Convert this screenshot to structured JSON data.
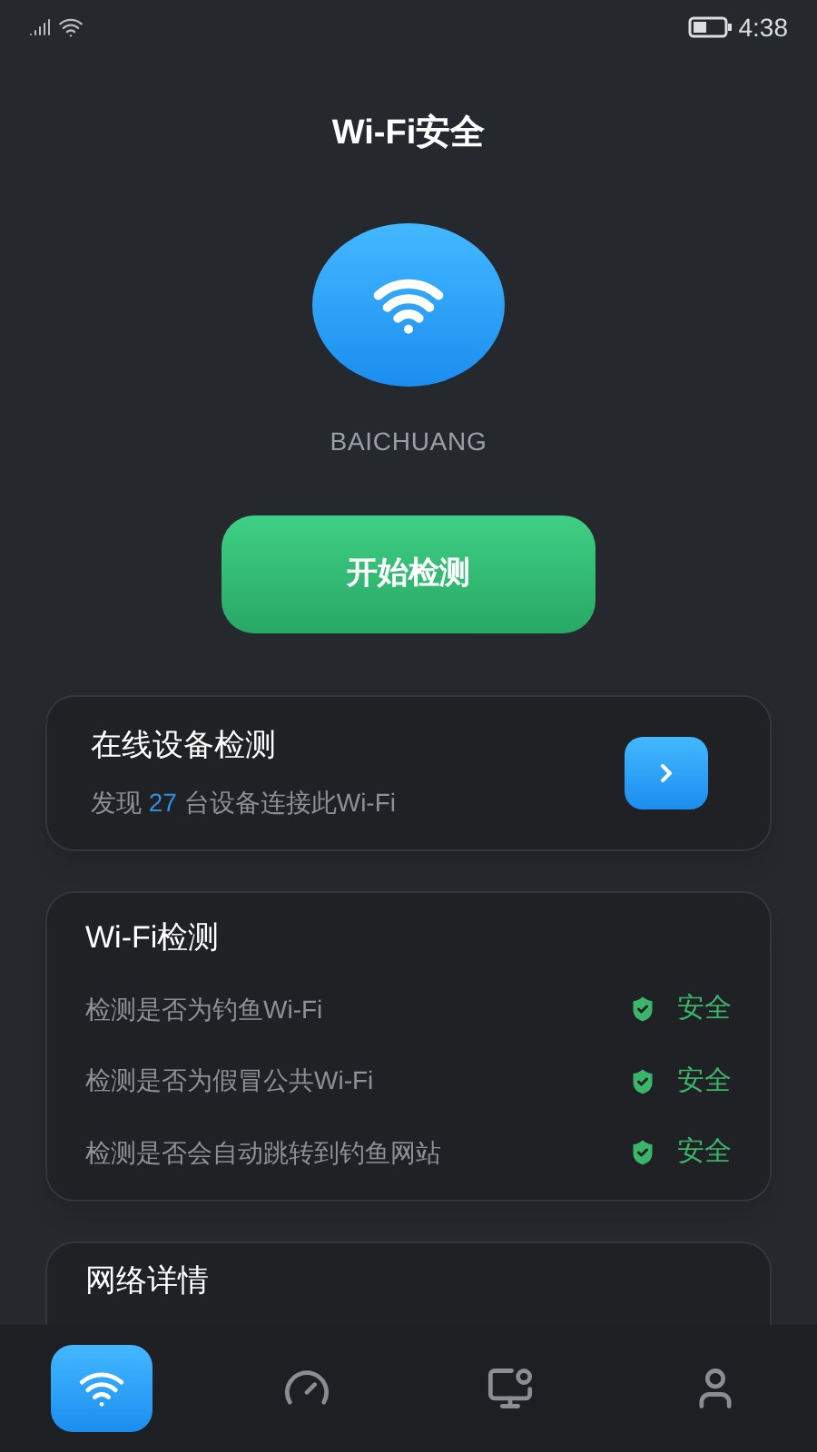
{
  "status_bar": {
    "time": "4:38"
  },
  "title": "Wi-Fi安全",
  "network": {
    "ssid": "BAICHUANG"
  },
  "start_button": "开始检测",
  "devices_card": {
    "title": "在线设备检测",
    "prefix": "发现",
    "count": "27",
    "suffix": "台设备连接此Wi-Fi"
  },
  "wifi_check": {
    "title": "Wi-Fi检测",
    "items": [
      {
        "label": "检测是否为钓鱼Wi-Fi",
        "result": "安全",
        "kind": "safe"
      },
      {
        "label": "检测是否为假冒公共Wi-Fi",
        "result": "安全",
        "kind": "safe"
      },
      {
        "label": "检测是否会自动跳转到钓鱼网站",
        "result": "安全",
        "kind": "safe"
      }
    ]
  },
  "details_card": {
    "title": "网络详情"
  },
  "nav": [
    {
      "selected": true
    },
    {
      "selected": false
    },
    {
      "selected": false
    },
    {
      "selected": false
    }
  ]
}
